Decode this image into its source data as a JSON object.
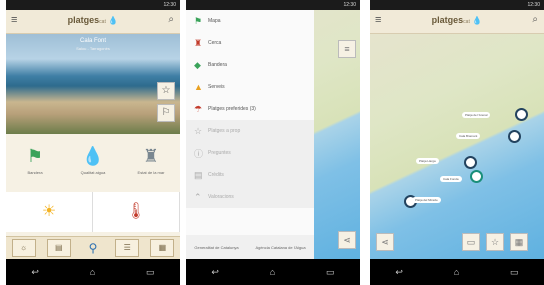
{
  "status": {
    "time": "12:30"
  },
  "app": {
    "logo_text": "platges",
    "logo_suffix": "cat"
  },
  "screen1": {
    "photo_title": "Cala Font",
    "photo_subtitle": "Salou - Tarragonès",
    "tiles": [
      {
        "icon": "flag-icon",
        "glyph": "⚑",
        "color": "#3aa35a",
        "label": "Bandera"
      },
      {
        "icon": "water-drop-icon",
        "glyph": "💧",
        "color": "#2a78c2",
        "label": "Qualitat aigua"
      },
      {
        "icon": "lifeguard-icon",
        "glyph": "♜",
        "color": "#7a8790",
        "label": "Estat de la mar"
      }
    ],
    "tabs": [
      {
        "icon": "weather-icon",
        "glyph": "☼"
      },
      {
        "icon": "info-icon",
        "glyph": "▤"
      },
      {
        "icon": "map-pin-icon",
        "glyph": "⚲",
        "label": "Mapa"
      },
      {
        "icon": "list-icon",
        "glyph": "☰"
      },
      {
        "icon": "document-icon",
        "glyph": "▦"
      }
    ]
  },
  "screen2": {
    "items": [
      {
        "icon": "flag-icon",
        "glyph": "⚑",
        "color": "#3aa35a",
        "label": "Mapa"
      },
      {
        "icon": "lifeguard-icon",
        "glyph": "♜",
        "color": "#c23a2a",
        "label": "Cerca"
      },
      {
        "icon": "fish-icon",
        "glyph": "◆",
        "color": "#3aa35a",
        "label": "Bandera"
      },
      {
        "icon": "beach-icon",
        "glyph": "▲",
        "color": "#e8a020",
        "label": "Serveis"
      },
      {
        "icon": "umbrella-icon",
        "glyph": "☂",
        "color": "#c23a2a",
        "label": "Platges preferides (3)"
      },
      {
        "icon": "star-icon",
        "glyph": "☆",
        "label": "Platges a prop",
        "dim": true
      },
      {
        "icon": "info-icon",
        "glyph": "ⓘ",
        "label": "Preguntes",
        "dim": true
      },
      {
        "icon": "document-icon",
        "glyph": "▤",
        "label": "Crèdits",
        "dim": true
      },
      {
        "icon": "arrow-up-icon",
        "glyph": "⌃",
        "label": "Valoracions",
        "dim": true
      }
    ],
    "footer": [
      "Generalitat de Catalunya",
      "Agència Catalana de l'Aigua"
    ]
  },
  "screen3": {
    "labels": [
      "Platja de l'Arenal",
      "Cala Bramant",
      "Platja Llarga",
      "Cala Fonda",
      "Platja del Miracle"
    ]
  }
}
